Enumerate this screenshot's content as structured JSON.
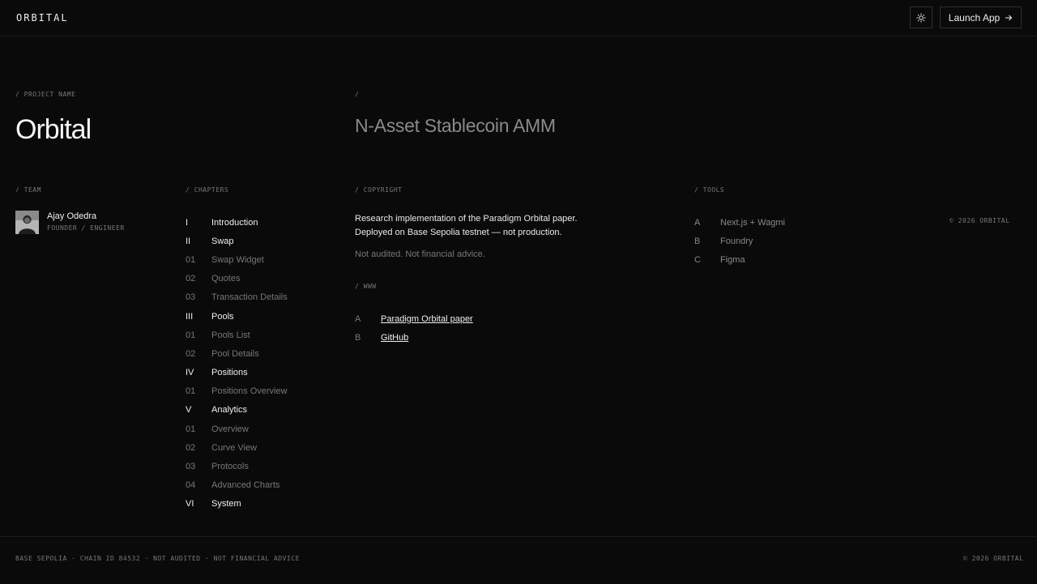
{
  "header": {
    "logo": "ORBITAL",
    "theme_toggle_icon": "sun-icon",
    "launch_label": "Launch App",
    "launch_icon": "arrow-right-icon"
  },
  "project": {
    "label": "/ PROJECT NAME",
    "name": "Orbital",
    "tagline_label": "/",
    "tagline": "N-Asset Stablecoin AMM"
  },
  "team": {
    "label": "/ TEAM",
    "members": [
      {
        "name": "Ajay Odedra",
        "role": "FOUNDER / ENGINEER"
      }
    ]
  },
  "chapters": {
    "label": "/ CHAPTERS",
    "items": [
      {
        "num": "I",
        "title": "Introduction",
        "level": "main"
      },
      {
        "num": "II",
        "title": "Swap",
        "level": "main"
      },
      {
        "num": "01",
        "title": "Swap Widget",
        "level": "sub"
      },
      {
        "num": "02",
        "title": "Quotes",
        "level": "sub"
      },
      {
        "num": "03",
        "title": "Transaction Details",
        "level": "sub"
      },
      {
        "num": "III",
        "title": "Pools",
        "level": "main"
      },
      {
        "num": "01",
        "title": "Pools List",
        "level": "sub"
      },
      {
        "num": "02",
        "title": "Pool Details",
        "level": "sub"
      },
      {
        "num": "IV",
        "title": "Positions",
        "level": "main"
      },
      {
        "num": "01",
        "title": "Positions Overview",
        "level": "sub"
      },
      {
        "num": "V",
        "title": "Analytics",
        "level": "main"
      },
      {
        "num": "01",
        "title": "Overview",
        "level": "sub"
      },
      {
        "num": "02",
        "title": "Curve View",
        "level": "sub"
      },
      {
        "num": "03",
        "title": "Protocols",
        "level": "sub"
      },
      {
        "num": "04",
        "title": "Advanced Charts",
        "level": "sub"
      },
      {
        "num": "VI",
        "title": "System",
        "level": "main"
      }
    ]
  },
  "copyright": {
    "label": "/ COPYRIGHT",
    "line1": "Research implementation of the Paradigm Orbital paper.",
    "line2": "Deployed on Base Sepolia testnet — not production.",
    "note": "Not audited. Not financial advice."
  },
  "www": {
    "label": "/ WWW",
    "links": [
      {
        "letter": "A",
        "text": "Paradigm Orbital paper"
      },
      {
        "letter": "B",
        "text": "GitHub"
      }
    ]
  },
  "tools": {
    "label": "/ TOOLS",
    "items": [
      {
        "letter": "A",
        "text": "Next.js + Wagmi"
      },
      {
        "letter": "B",
        "text": "Foundry"
      },
      {
        "letter": "C",
        "text": "Figma"
      }
    ],
    "copyright": "© 2026 ORBITAL"
  },
  "footer": {
    "status": "BASE SEPOLIA · CHAIN ID 84532 · NOT AUDITED · NOT FINANCIAL ADVICE",
    "copyright": "© 2026 ORBITAL"
  }
}
